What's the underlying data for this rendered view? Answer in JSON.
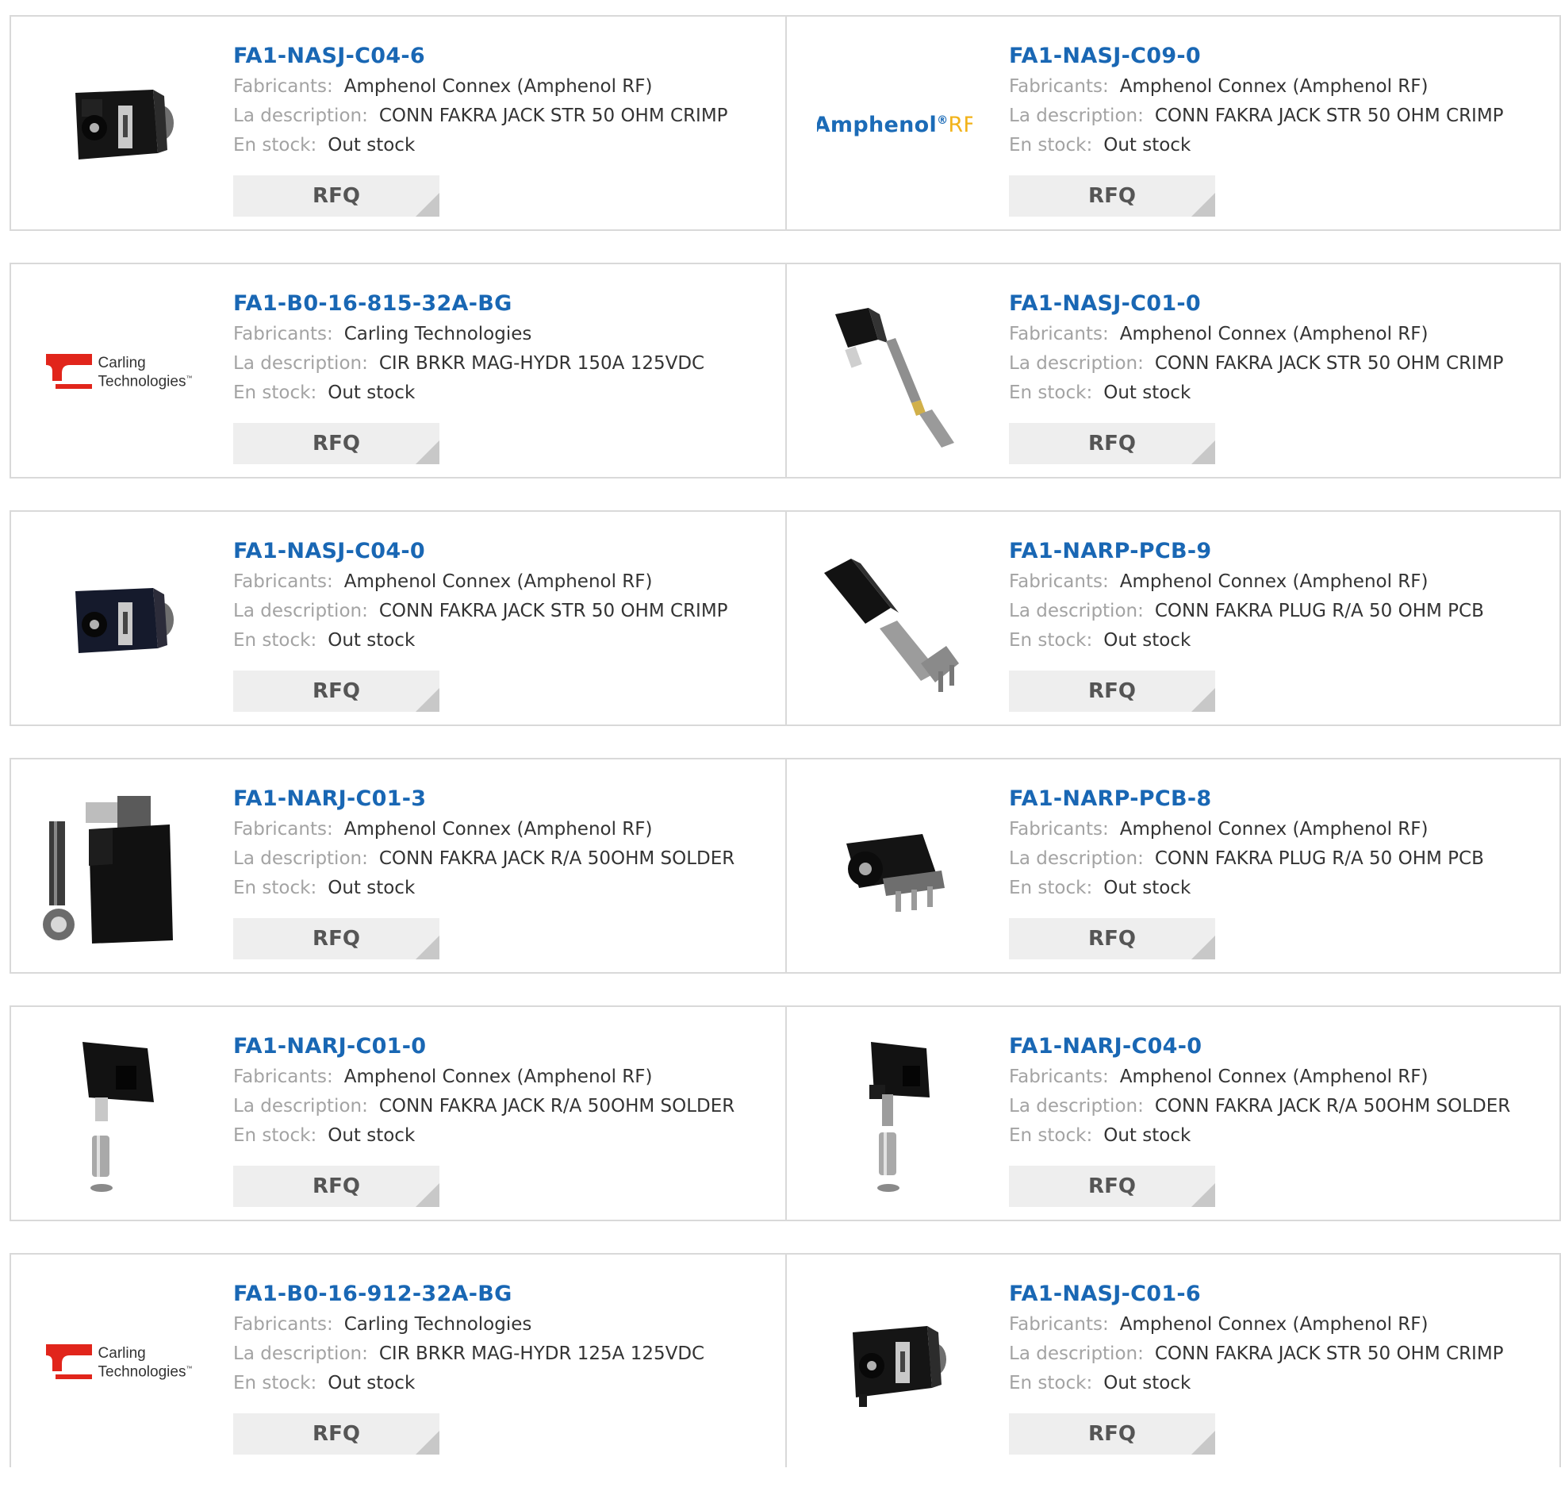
{
  "labels": {
    "manufacturer": "Fabricants:",
    "description": "La description:",
    "stock": "En stock:",
    "rfq": "RFQ"
  },
  "colors": {
    "link": "#1967b4",
    "label": "#a3a3a3",
    "value": "#333333",
    "button_bg": "#eeeeee",
    "border": "#d9d9d9"
  },
  "products": [
    {
      "part_number": "FA1-NASJ-C04-6",
      "manufacturer": "Amphenol Connex (Amphenol RF)",
      "description": "CONN FAKRA JACK STR 50 OHM CRIMP",
      "stock": "Out stock",
      "image": "fakra-jack-straight-photo"
    },
    {
      "part_number": "FA1-NASJ-C09-0",
      "manufacturer": "Amphenol Connex (Amphenol RF)",
      "description": "CONN FAKRA JACK STR 50 OHM CRIMP",
      "stock": "Out stock",
      "image": "amphenol-rf-logo",
      "brand": {
        "name": "Amphenol",
        "reg": "®",
        "suffix": "RF"
      }
    },
    {
      "part_number": "FA1-B0-16-815-32A-BG",
      "manufacturer": "Carling Technologies",
      "description": "CIR BRKR MAG-HYDR 150A 125VDC",
      "stock": "Out stock",
      "image": "carling-technologies-logo",
      "brand": {
        "line1": "Carling",
        "line2": "Technologies",
        "tm": "™"
      }
    },
    {
      "part_number": "FA1-NASJ-C01-0",
      "manufacturer": "Amphenol Connex (Amphenol RF)",
      "description": "CONN FAKRA JACK STR 50 OHM CRIMP",
      "stock": "Out stock",
      "image": "fakra-jack-crimp-kit-photo"
    },
    {
      "part_number": "FA1-NASJ-C04-0",
      "manufacturer": "Amphenol Connex (Amphenol RF)",
      "description": "CONN FAKRA JACK STR 50 OHM CRIMP",
      "stock": "Out stock",
      "image": "fakra-jack-straight-photo"
    },
    {
      "part_number": "FA1-NARP-PCB-9",
      "manufacturer": "Amphenol Connex (Amphenol RF)",
      "description": "CONN FAKRA PLUG R/A 50 OHM PCB",
      "stock": "Out stock",
      "image": "fakra-plug-right-angle-photo"
    },
    {
      "part_number": "FA1-NARJ-C01-3",
      "manufacturer": "Amphenol Connex (Amphenol RF)",
      "description": "CONN FAKRA JACK R/A 50OHM SOLDER",
      "stock": "Out stock",
      "image": "fakra-jack-right-angle-kit-photo"
    },
    {
      "part_number": "FA1-NARP-PCB-8",
      "manufacturer": "Amphenol Connex (Amphenol RF)",
      "description": "CONN FAKRA PLUG R/A 50 OHM PCB",
      "stock": "Out stock",
      "image": "fakra-plug-pcb-photo"
    },
    {
      "part_number": "FA1-NARJ-C01-0",
      "manufacturer": "Amphenol Connex (Amphenol RF)",
      "description": "CONN FAKRA JACK R/A 50OHM SOLDER",
      "stock": "Out stock",
      "image": "fakra-jack-ferrule-photo"
    },
    {
      "part_number": "FA1-NARJ-C04-0",
      "manufacturer": "Amphenol Connex (Amphenol RF)",
      "description": "CONN FAKRA JACK R/A 50OHM SOLDER",
      "stock": "Out stock",
      "image": "fakra-jack-ferrule-photo"
    },
    {
      "part_number": "FA1-B0-16-912-32A-BG",
      "manufacturer": "Carling Technologies",
      "description": "CIR BRKR MAG-HYDR 125A 125VDC",
      "stock": "Out stock",
      "image": "carling-technologies-logo",
      "brand": {
        "line1": "Carling",
        "line2": "Technologies",
        "tm": "™"
      }
    },
    {
      "part_number": "FA1-NASJ-C01-6",
      "manufacturer": "Amphenol Connex (Amphenol RF)",
      "description": "CONN FAKRA JACK STR 50 OHM CRIMP",
      "stock": "Out stock",
      "image": "fakra-jack-straight-photo"
    }
  ]
}
